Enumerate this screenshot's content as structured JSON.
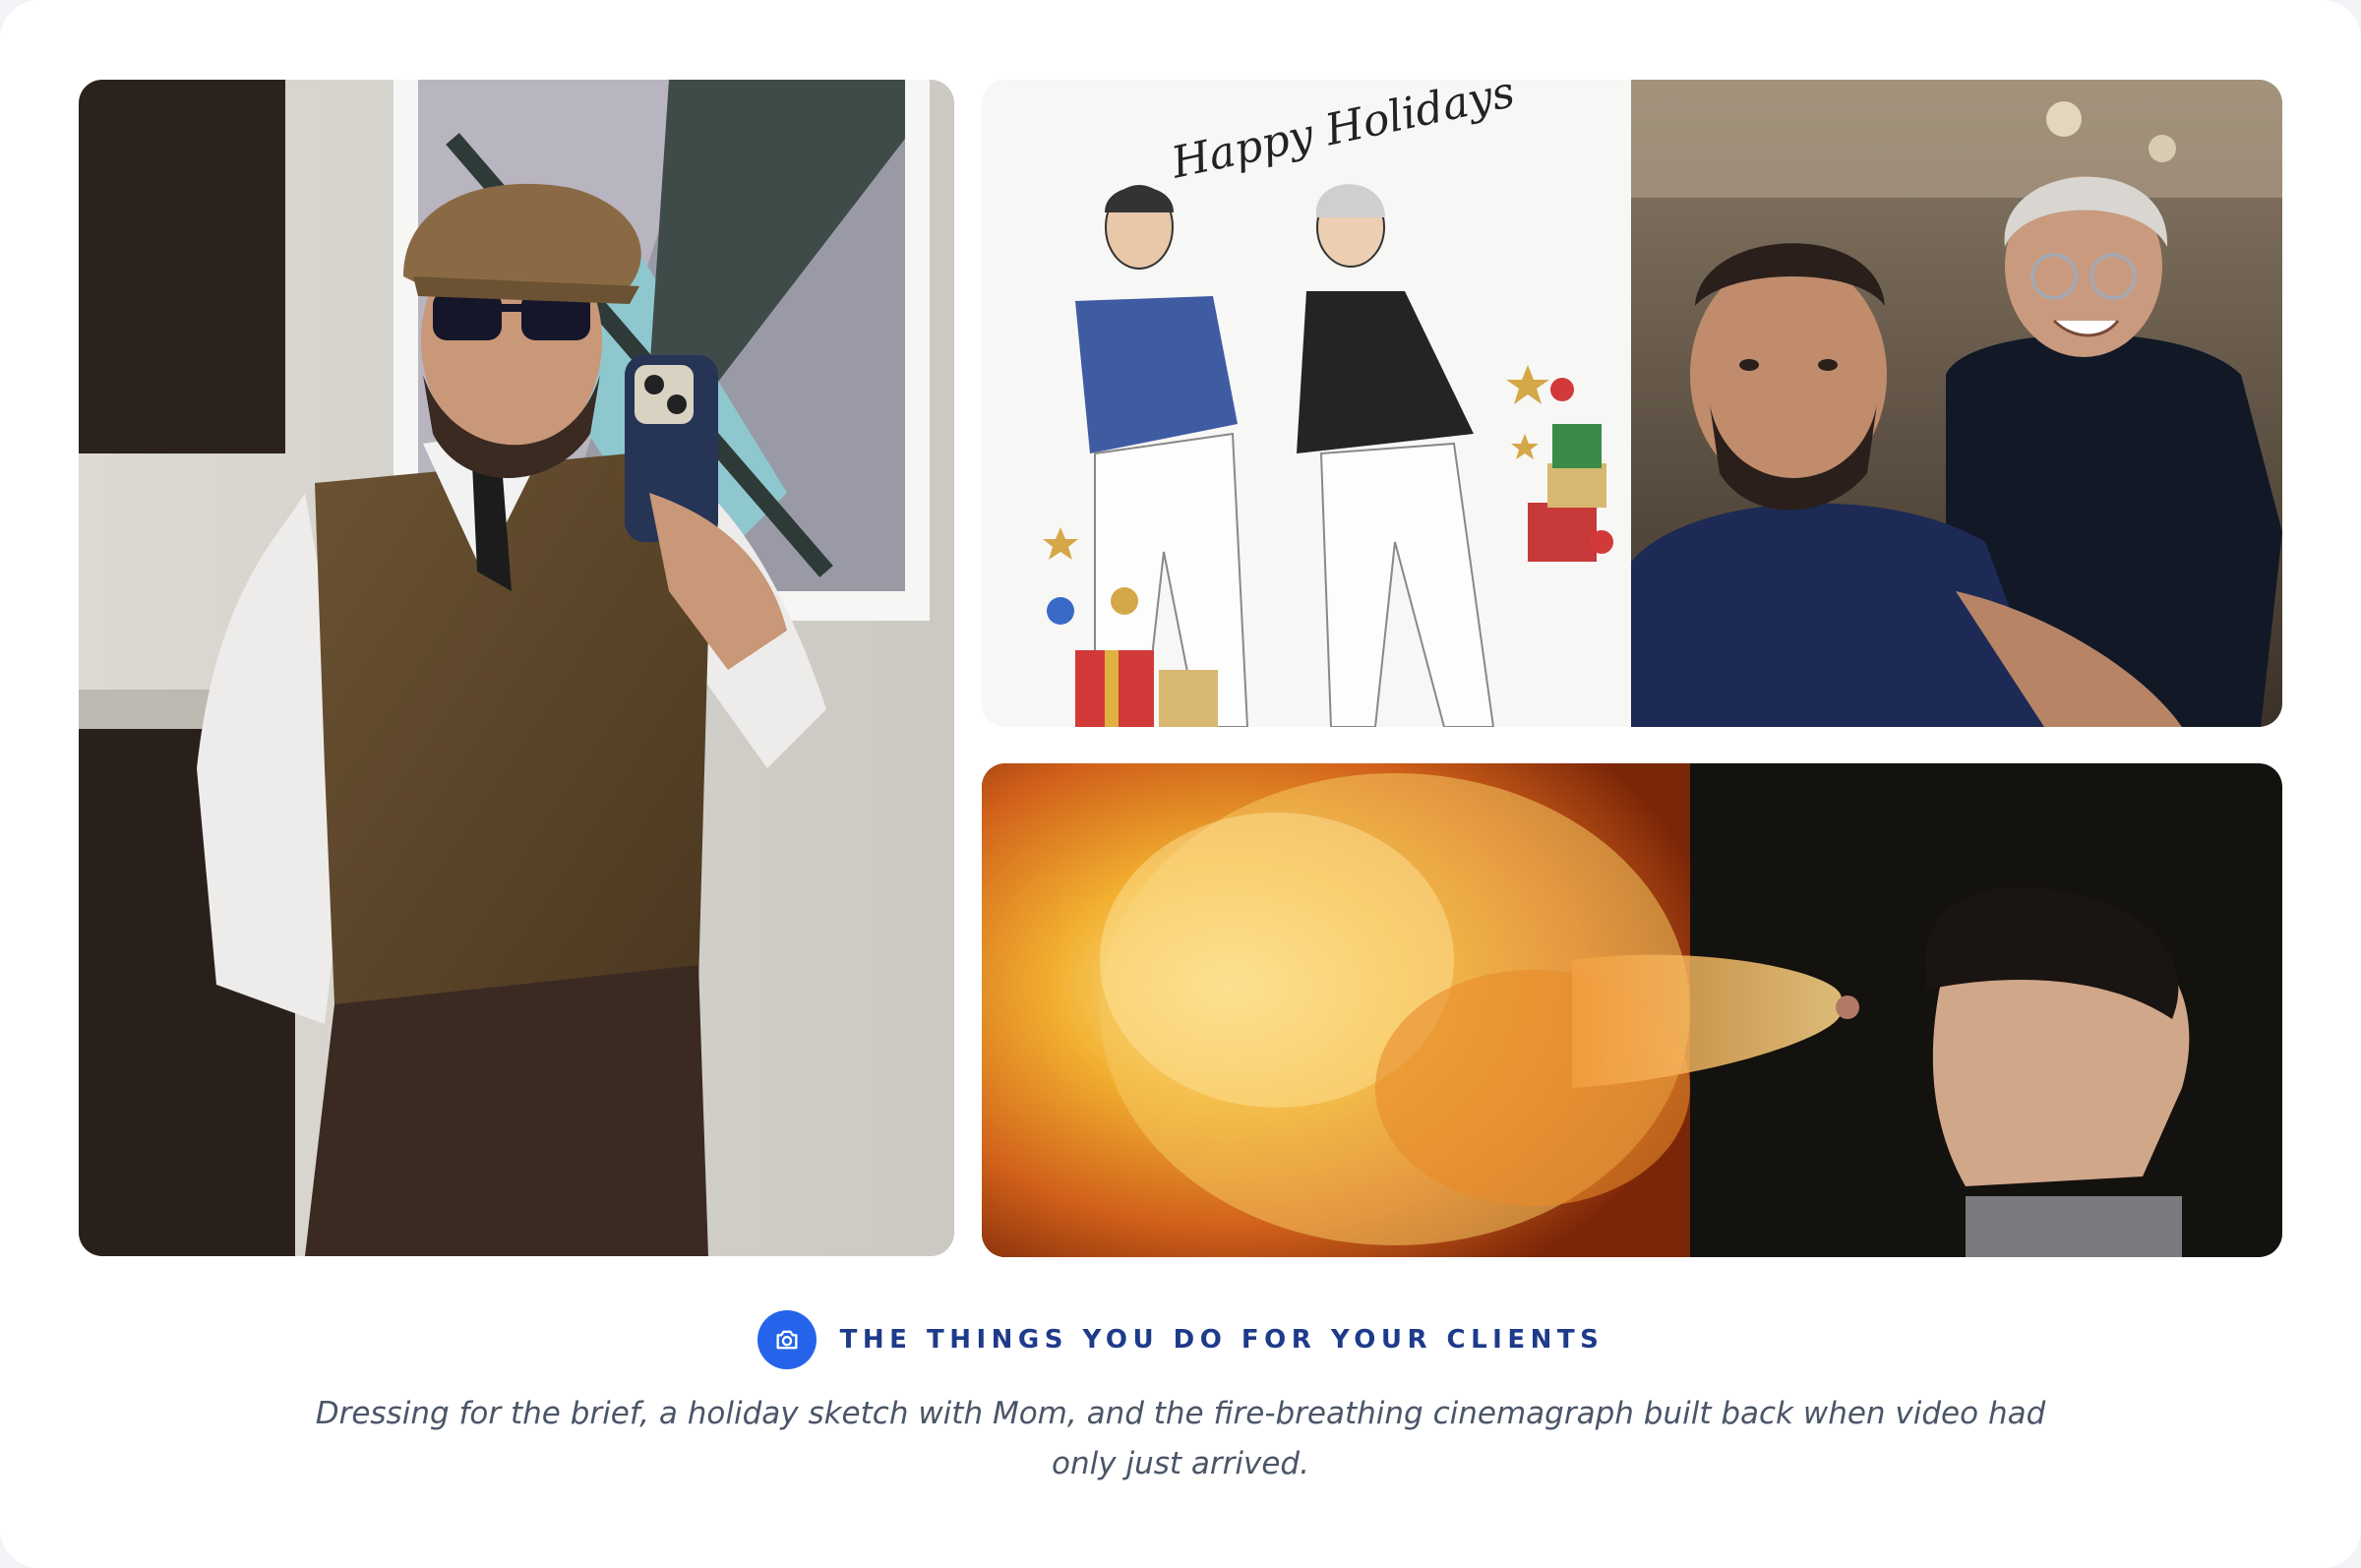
{
  "gallery": {
    "photos": [
      {
        "id": "selfie",
        "alt": "man in vest and cap taking a mirror selfie"
      },
      {
        "id": "sketch",
        "sketch_text": "Happy Holidays"
      },
      {
        "id": "mom",
        "alt": "selfie with mom"
      },
      {
        "id": "fire",
        "alt": "fire-breathing cinemagraph"
      }
    ]
  },
  "caption": {
    "icon": "camera-icon",
    "heading": "THE THINGS YOU DO FOR YOUR CLIENTS",
    "description": "Dressing for the brief, a holiday sketch with Mom, and the fire-breathing cinemagraph built back when video had only just arrived."
  },
  "colors": {
    "accent": "#2563eb",
    "heading": "#1e3a8a",
    "body_text": "#4a5568"
  }
}
